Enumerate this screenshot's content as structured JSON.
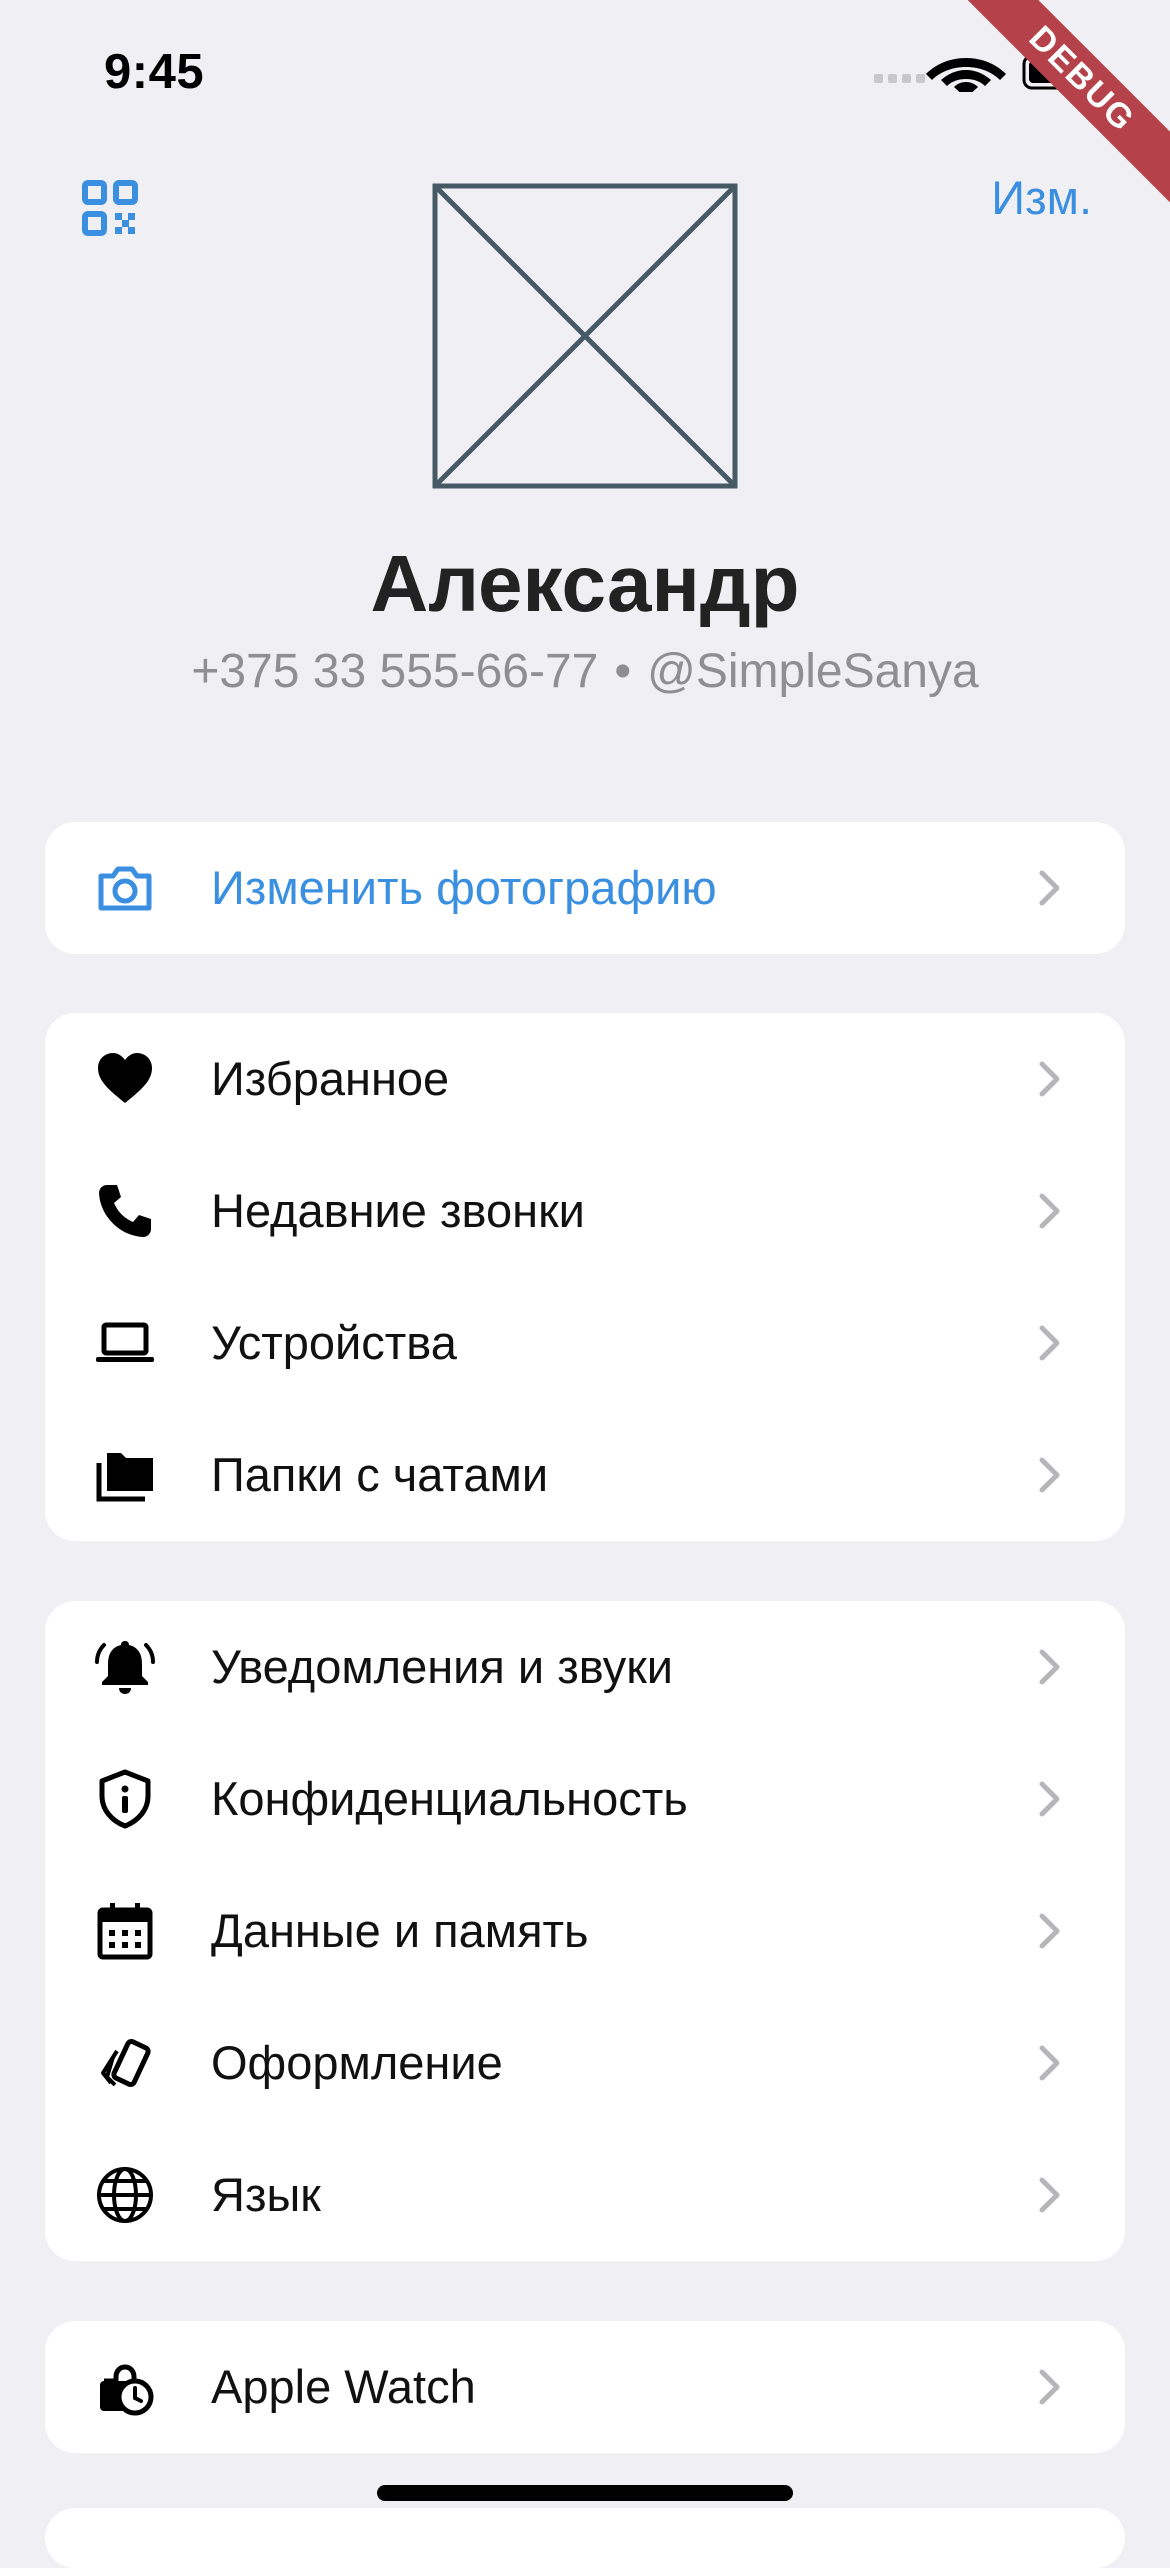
{
  "status_bar": {
    "time": "9:45",
    "signal_icon": "cellular-signal-icon",
    "wifi_icon": "wifi-icon",
    "battery_icon": "battery-icon"
  },
  "debug_banner": "DEBUG",
  "header": {
    "qr_icon": "qr-code-icon",
    "edit_label": "Изм."
  },
  "profile": {
    "avatar_icon": "image-placeholder-icon",
    "name": "Александр",
    "phone": "+375 33 555-66-77",
    "separator": "•",
    "username": "@SimpleSanya"
  },
  "groups": [
    {
      "items": [
        {
          "icon": "camera-icon",
          "label": "Изменить фотографию",
          "accent": true
        }
      ]
    },
    {
      "items": [
        {
          "icon": "heart-icon",
          "label": "Избранное"
        },
        {
          "icon": "phone-icon",
          "label": "Недавние звонки"
        },
        {
          "icon": "laptop-icon",
          "label": "Устройства"
        },
        {
          "icon": "folders-icon",
          "label": "Папки с чатами"
        }
      ]
    },
    {
      "items": [
        {
          "icon": "bell-icon",
          "label": "Уведомления и звуки"
        },
        {
          "icon": "shield-info-icon",
          "label": "Конфиденциальность"
        },
        {
          "icon": "calendar-icon",
          "label": "Данные и память"
        },
        {
          "icon": "appearance-icon",
          "label": "Оформление"
        },
        {
          "icon": "globe-icon",
          "label": "Язык"
        }
      ]
    },
    {
      "items": [
        {
          "icon": "watch-icon",
          "label": "Apple Watch"
        }
      ]
    }
  ],
  "colors": {
    "accent": "#3b8fe0",
    "background": "#efeff4",
    "card": "#ffffff",
    "secondary_text": "#8e8e93",
    "debug_banner": "#b5424a"
  }
}
